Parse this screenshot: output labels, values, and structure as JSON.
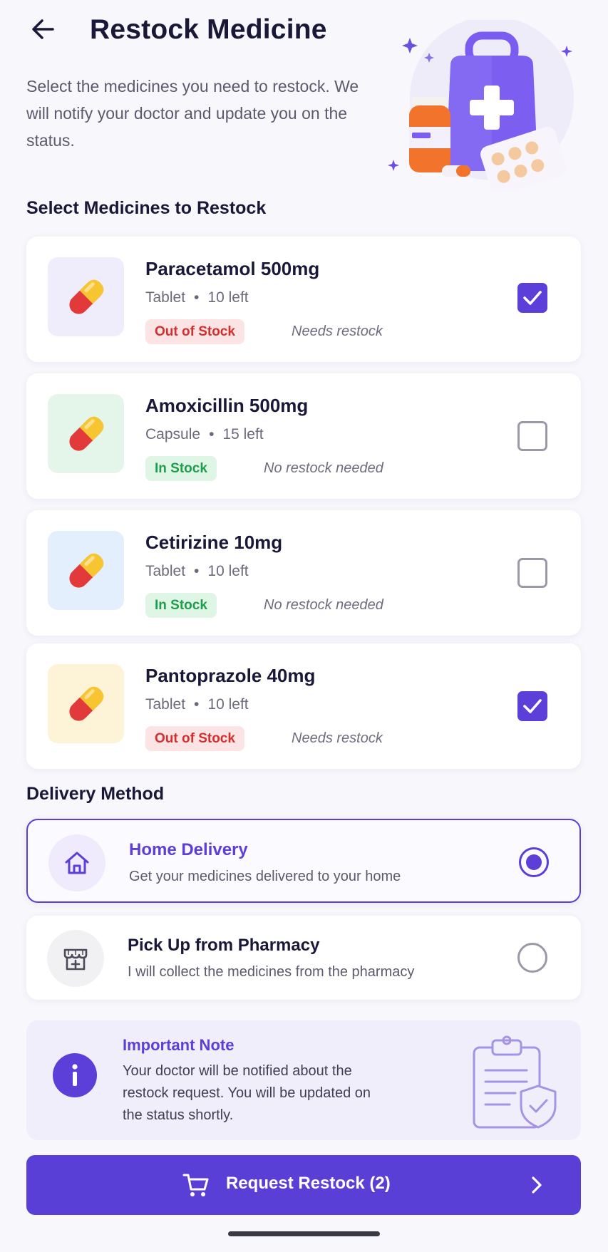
{
  "header": {
    "title": "Restock Medicine",
    "subtitle": "Select the medicines you need to restock. We will notify your doctor and update you on the status."
  },
  "medicines_section": {
    "title": "Select Medicines to Restock",
    "items": [
      {
        "name": "Paracetamol 500mg",
        "form": "Tablet",
        "qty": "10 left",
        "status": "Out of Stock",
        "status_type": "out",
        "note": "Needs restock",
        "checked": true,
        "thumb_color": "#efecfb"
      },
      {
        "name": "Amoxicillin 500mg",
        "form": "Capsule",
        "qty": "15 left",
        "status": "In Stock",
        "status_type": "in",
        "note": "No restock needed",
        "checked": false,
        "thumb_color": "#e3f6e9"
      },
      {
        "name": "Cetirizine 10mg",
        "form": "Tablet",
        "qty": "10 left",
        "status": "In Stock",
        "status_type": "in",
        "note": "No restock needed",
        "checked": false,
        "thumb_color": "#e3effd"
      },
      {
        "name": "Pantoprazole 40mg",
        "form": "Tablet",
        "qty": "10 left",
        "status": "Out of Stock",
        "status_type": "out",
        "note": "Needs restock",
        "checked": true,
        "thumb_color": "#fdf3d6"
      }
    ]
  },
  "delivery_section": {
    "title": "Delivery Method",
    "options": [
      {
        "title": "Home Delivery",
        "description": "Get your medicines delivered to your home",
        "selected": true,
        "icon": "home-icon"
      },
      {
        "title": "Pick Up from Pharmacy",
        "description": "I will collect the medicines from the pharmacy",
        "selected": false,
        "icon": "pharmacy-store-icon"
      }
    ]
  },
  "note": {
    "title": "Important Note",
    "body": "Your doctor will be notified about the restock request. You will be updated on the status shortly."
  },
  "cta": {
    "label": "Request Restock (2)"
  },
  "colors": {
    "accent": "#5b3fd8",
    "out_of_stock": "#d32f2f",
    "in_stock": "#1e9e4a"
  }
}
